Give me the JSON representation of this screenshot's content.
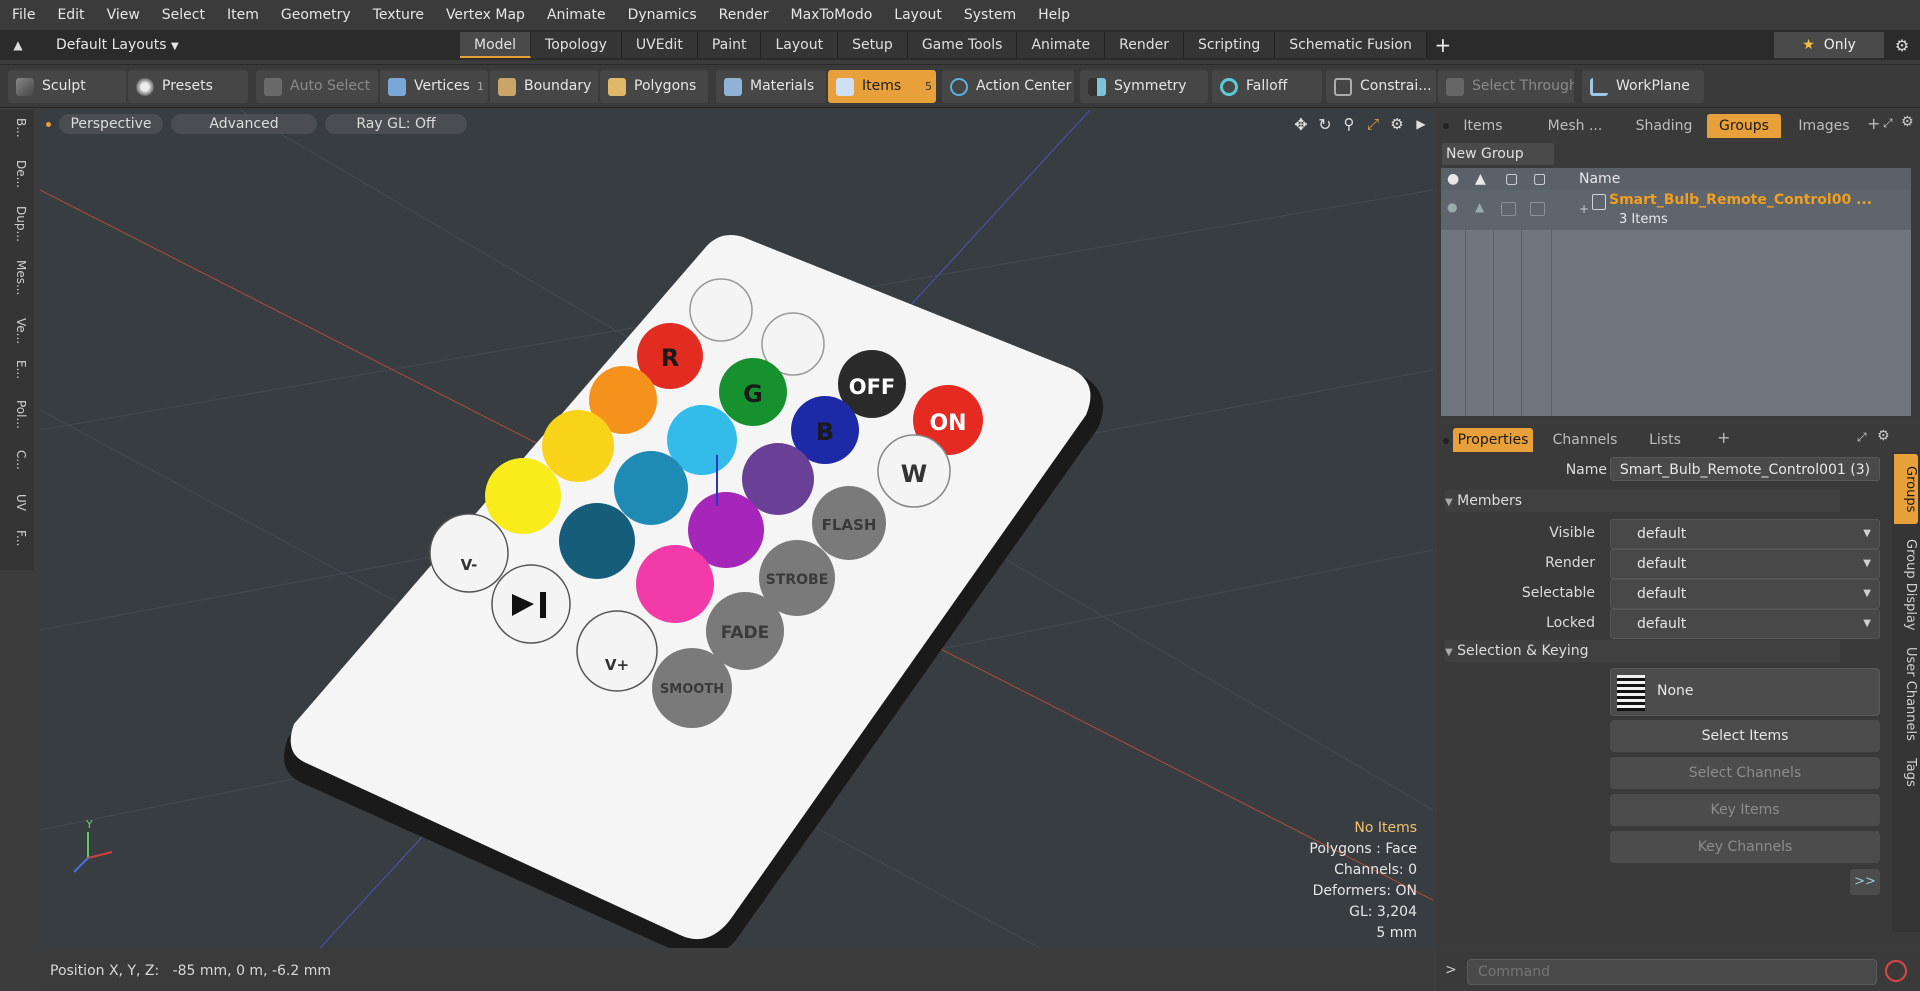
{
  "menu": [
    "File",
    "Edit",
    "View",
    "Select",
    "Item",
    "Geometry",
    "Texture",
    "Vertex Map",
    "Animate",
    "Dynamics",
    "Render",
    "MaxToModo",
    "Layout",
    "System",
    "Help"
  ],
  "layouts": {
    "selector": "Default Layouts",
    "tabs": [
      "Model",
      "Topology",
      "UVEdit",
      "Paint",
      "Layout",
      "Setup",
      "Game Tools",
      "Animate",
      "Render",
      "Scripting",
      "Schematic Fusion"
    ],
    "active": "Model",
    "only_label": "Only"
  },
  "toolbar": {
    "sculpt": "Sculpt",
    "presets": "Presets",
    "auto_select": "Auto Select",
    "vertices": "Vertices",
    "vertices_count": "1",
    "boundary": "Boundary",
    "polygons": "Polygons",
    "materials": "Materials",
    "items": "Items",
    "items_count": "5",
    "action_center": "Action Center",
    "symmetry": "Symmetry",
    "falloff": "Falloff",
    "constraints": "Constrai...",
    "select_through": "Select Through",
    "workplane": "WorkPlane"
  },
  "left_tabs": [
    "B...",
    "De...",
    "Dup...",
    "Mes...",
    "Ve...",
    "E...",
    "Pol...",
    "C...",
    "UV",
    "F..."
  ],
  "viewport": {
    "view": "Perspective",
    "advanced": "Advanced",
    "raygl": "Ray GL: Off",
    "info": {
      "items": "No Items",
      "polygons": "Polygons : Face",
      "channels": "Channels: 0",
      "deformers": "Deformers: ON",
      "gl": "GL: 3,204",
      "unit": "5 mm"
    },
    "remote_buttons": {
      "off": "OFF",
      "on": "ON",
      "r": "R",
      "g": "G",
      "b": "B",
      "w": "W",
      "flash": "FLASH",
      "strobe": "STROBE",
      "fade": "FADE",
      "smooth": "SMOOTH",
      "v_minus": "V-",
      "v_plus": "V+"
    },
    "axis_y": "Y"
  },
  "status": {
    "label": "Position X, Y, Z:",
    "value": "-85 mm, 0 m, -6.2 mm"
  },
  "scene_panel": {
    "tabs": [
      "Items",
      "Mesh ...",
      "Shading",
      "Groups",
      "Images"
    ],
    "active": "Groups",
    "new_group": "New Group",
    "col_name": "Name",
    "group_name": "Smart_Bulb_Remote_Control00 ...",
    "group_count": "3 Items"
  },
  "props_panel": {
    "tabs": [
      "Properties",
      "Channels",
      "Lists"
    ],
    "active": "Properties",
    "name_label": "Name",
    "name_value": "Smart_Bulb_Remote_Control001 (3)",
    "members": "Members",
    "fields": [
      {
        "label": "Visible",
        "value": "default"
      },
      {
        "label": "Render",
        "value": "default"
      },
      {
        "label": "Selectable",
        "value": "default"
      },
      {
        "label": "Locked",
        "value": "default"
      }
    ],
    "selection_keying": "Selection & Keying",
    "none_label": "None",
    "select_items": "Select Items",
    "select_channels": "Select Channels",
    "key_items": "Key Items",
    "key_channels": "Key Channels",
    "more": ">>",
    "side_tabs": [
      "Groups",
      "Group Display",
      "User Channels",
      "Tags"
    ]
  },
  "command": {
    "placeholder": "Command",
    "prompt": ">"
  },
  "colors": {
    "accent": "#e8a03a",
    "group_text": "#f0a020"
  }
}
